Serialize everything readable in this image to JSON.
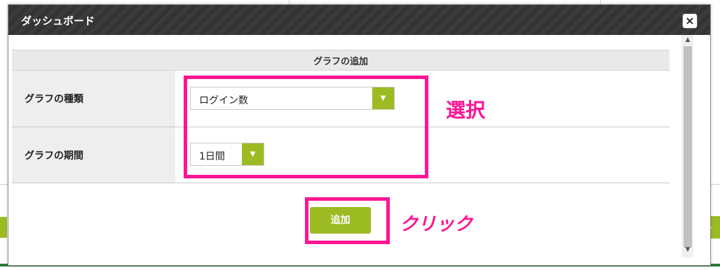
{
  "modal": {
    "title": "ダッシュボード",
    "close_label": "×"
  },
  "form": {
    "section_title": "グラフの追加",
    "rows": [
      {
        "label": "グラフの種類",
        "selected": "ログイン数"
      },
      {
        "label": "グラフの期間",
        "selected": "1日間"
      }
    ],
    "add_button": "追加"
  },
  "annotations": {
    "select": "選択",
    "click": "クリック"
  },
  "icons": {
    "dropdown": "▼",
    "close": "×",
    "download": "download-icon",
    "scroll_up": "▲",
    "scroll_down": "▼"
  },
  "colors": {
    "accent_green": "#9cbb23",
    "annotation_pink": "#ff1493",
    "header_dark": "#383838"
  }
}
